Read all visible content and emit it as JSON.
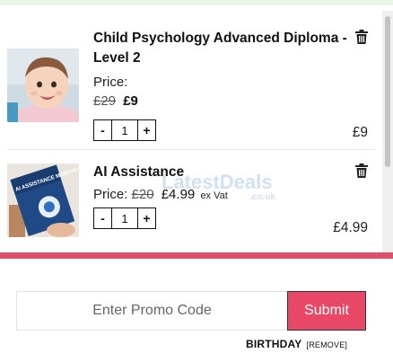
{
  "cart": {
    "items": [
      {
        "title": "Child Psychology Advanced Diploma - Level 2",
        "price_label": "Price:",
        "old_price": "£29",
        "new_price": "£9",
        "quantity": "1",
        "line_total": "£9",
        "image": "baby-photo"
      },
      {
        "title": "AI Assistance",
        "price_label": "Price:",
        "old_price": "£20",
        "new_price": "£4.99",
        "vat_note": "ex Vat",
        "quantity": "1",
        "line_total": "£4.99",
        "image": "ai-assistance-book-cover",
        "cover_text": "AI ASSISTANCE MONTHLY"
      }
    ],
    "qty_minus_label": "-",
    "qty_plus_label": "+",
    "delete_icon": "trash-icon"
  },
  "watermark": {
    "text": "LatestDeals",
    "sub": ".co.uk"
  },
  "promo": {
    "placeholder": "Enter Promo Code",
    "submit_label": "Submit",
    "applied_code": "BIRTHDAY",
    "remove_label": "[REMOVE]"
  },
  "colors": {
    "accent": "#e04e6b",
    "submit_bg": "#e84866",
    "top_strip": "#e9f5e4"
  }
}
